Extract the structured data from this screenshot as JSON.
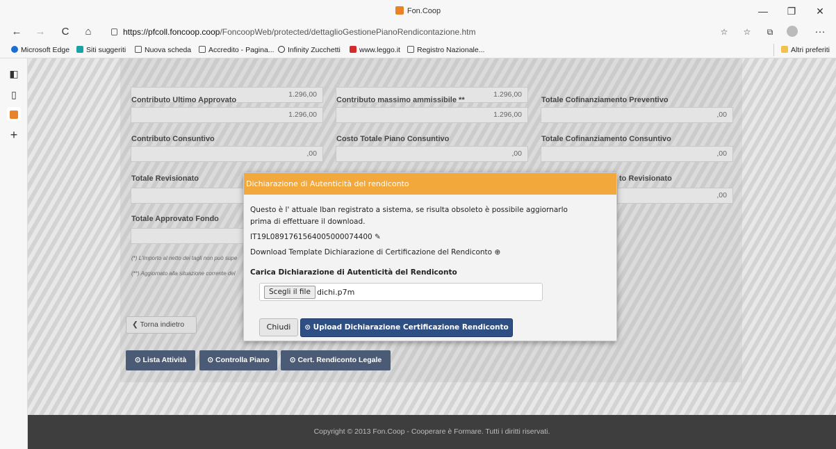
{
  "window": {
    "title": "Fon.Coop",
    "minimize": "—",
    "maximize": "❐",
    "close": "✕"
  },
  "nav": {
    "back": "←",
    "forward": "→",
    "reload": "C",
    "home": "⌂",
    "url_host": "https://pfcoll.foncoop.coop",
    "url_path": "/FoncoopWeb/protected/dettaglioGestionePianoRendicontazione.htm",
    "more": "···"
  },
  "favorites": [
    {
      "label": "Microsoft Edge",
      "color": "#1b6fd1"
    },
    {
      "label": "Siti suggeriti",
      "color": "#1aa1a5"
    },
    {
      "label": "Nuova scheda",
      "color": "#ffffff"
    },
    {
      "label": "Accredito - Pagina...",
      "color": "#ffffff"
    },
    {
      "label": "Infinity Zucchetti",
      "color": "#222222"
    },
    {
      "label": "www.leggo.it",
      "color": "#d42a2a"
    },
    {
      "label": "Registro Nazionale...",
      "color": "#ffffff"
    }
  ],
  "favorites_other": "Altri preferiti",
  "sidebar": {
    "new_tab": "+"
  },
  "form": {
    "row0": {
      "val1": "1.296,00",
      "val2": "1.296,00"
    },
    "row1": {
      "label1": "Contributo Ultimo Approvato",
      "val1": "1.296,00",
      "label2": "Contributo massimo ammissibile **",
      "val2": "1.296,00",
      "label3": "Totale Cofinanziamento Preventivo",
      "val3": ",00"
    },
    "row2": {
      "label1": "Contributo Consuntivo",
      "val1": ",00",
      "label2": "Costo Totale Piano Consuntivo",
      "val2": ",00",
      "label3": "Totale Cofinanziamento Consuntivo",
      "val3": ",00"
    },
    "row3": {
      "label1": "Totale Revisionato",
      "label3_partial": "to Revisionato",
      "val3": ",00"
    },
    "row4": {
      "label1": "Totale Approvato Fondo"
    },
    "note1": "(*) L'importo al netto dei tagli non può supe",
    "note2": "(**) Aggiornato alla situazione corrente del"
  },
  "buttons": {
    "back": "❮ Torna indietro",
    "lista": "⊙ Lista Attività",
    "controlla": "⊙ Controlla Piano",
    "cert": "⊙ Cert. Rendiconto Legale"
  },
  "footer": "Copyright © 2013 Fon.Coop - Cooperare è Formare. Tutti i diritti riservati.",
  "modal": {
    "title": "Dichiarazione di Autenticità del rendiconto",
    "text1": "Questo è l' attuale Iban registrato a sistema, se risulta obsoleto è possibile aggiornarlo",
    "text2": "prima di effettuare il download.",
    "iban": "IT19L0891761564005000074400",
    "edit_icon": "✎",
    "download": "Download Template Dichiarazione di Certificazione del Rendiconto",
    "download_icon": "⊕",
    "upload_label": "Carica Dichiarazione di Autenticità del Rendiconto",
    "file_button": "Scegli il file",
    "file_name": "dichi.p7m",
    "close": "Chiudi",
    "upload": "⊙ Upload Dichiarazione Certificazione Rendiconto"
  }
}
